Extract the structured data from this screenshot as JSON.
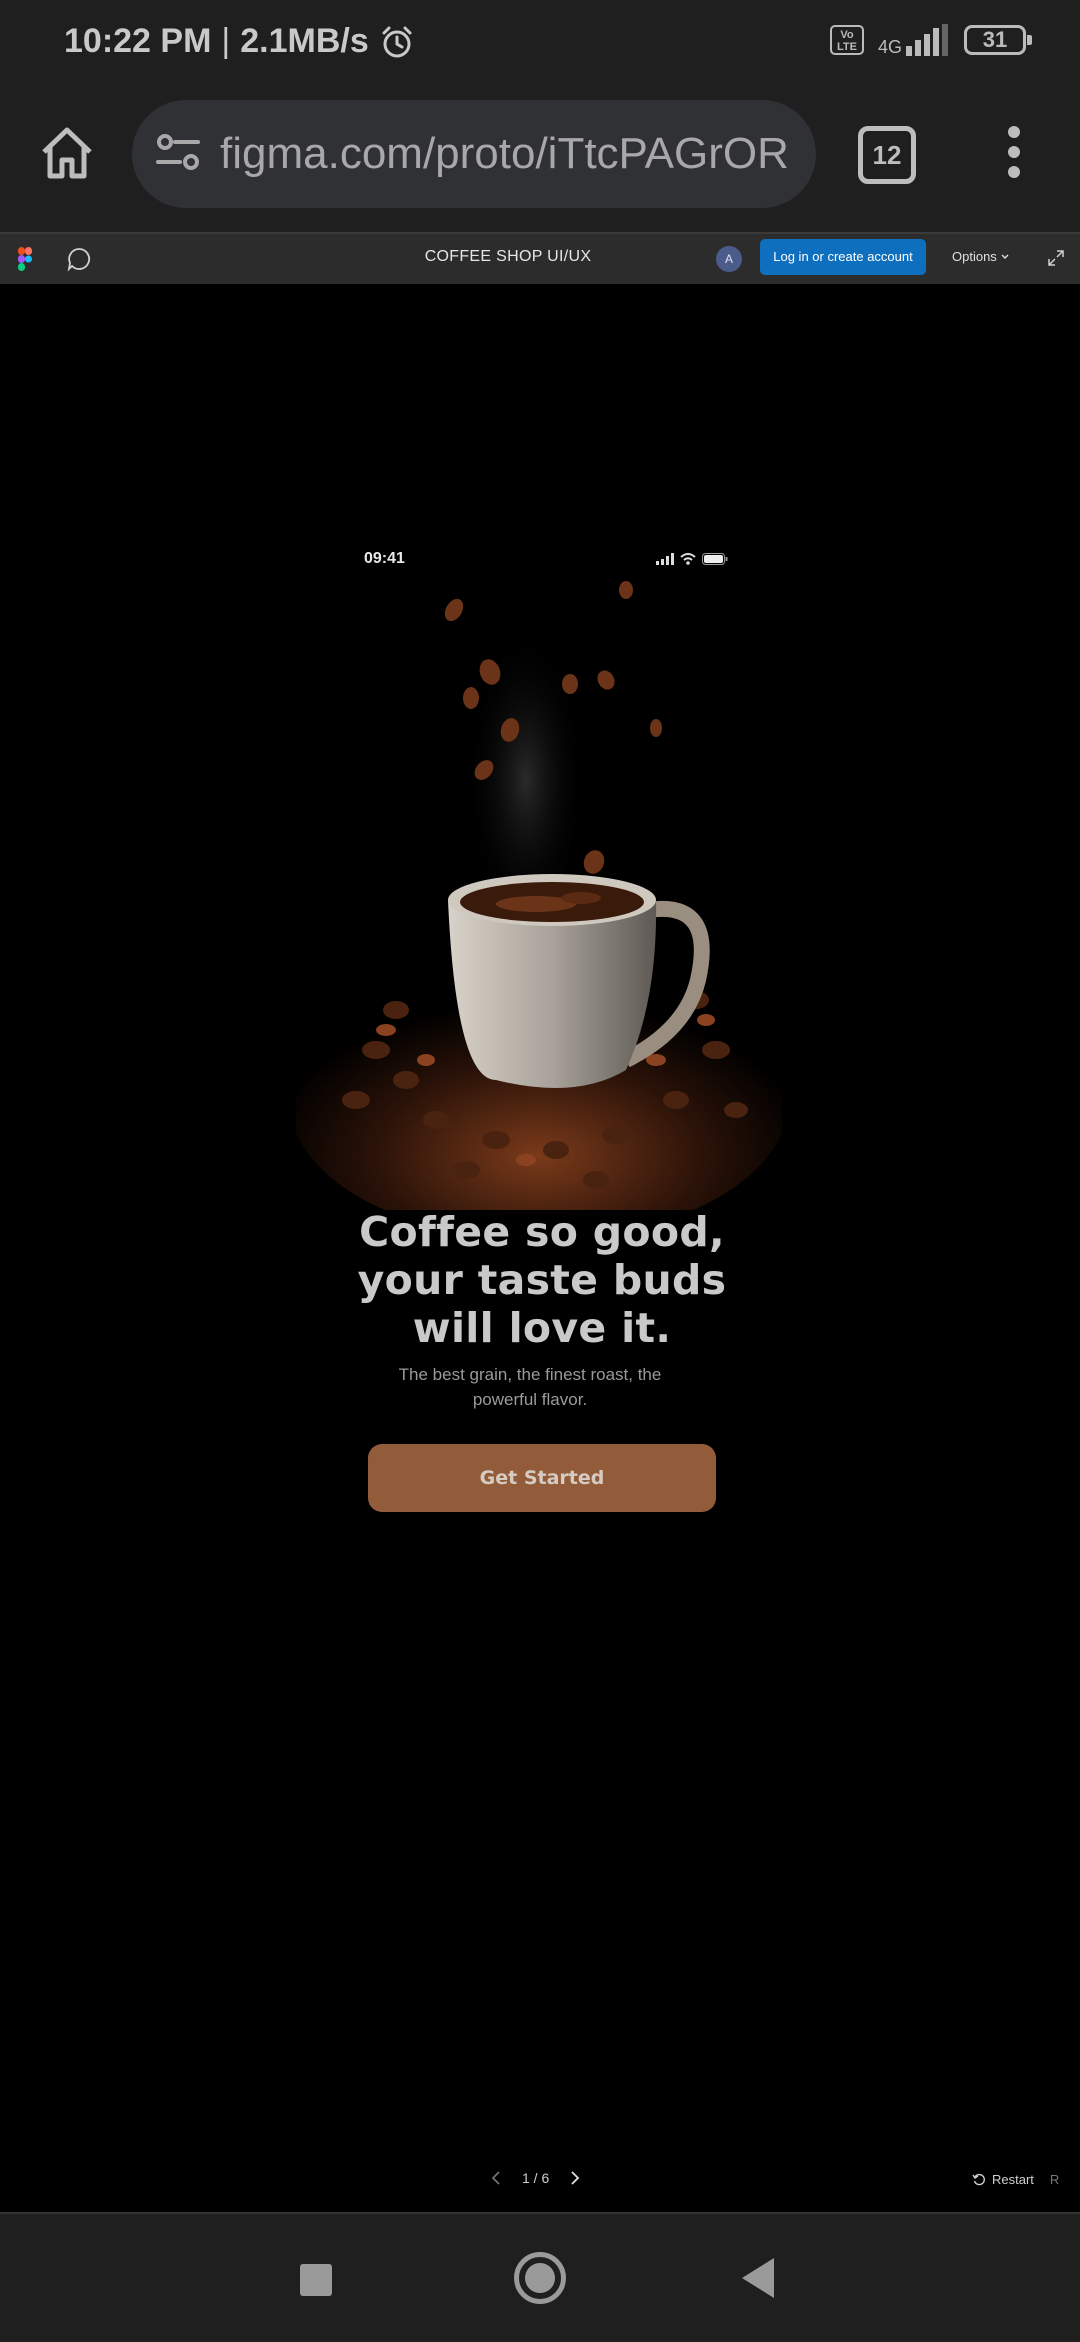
{
  "status_bar": {
    "time": "10:22 PM",
    "separator": "|",
    "speed": "2.1MB/s",
    "alarm_icon": "alarm-icon",
    "volte": "Vo LTE",
    "network": "4G",
    "battery": "31"
  },
  "browser": {
    "url": "figma.com/proto/iTtcPAGrOR",
    "tab_count": "12",
    "icons": [
      "home-icon",
      "site-settings-icon",
      "tabs-icon",
      "more-vert-icon"
    ]
  },
  "figma_header": {
    "title": "COFFEE SHOP UI/UX",
    "avatar": "A",
    "login": "Log in or create account",
    "options": "Options",
    "colors": {
      "login_bg": "#0d6fbd",
      "bar_bg": "#2c2c2c"
    }
  },
  "prototype": {
    "time": "09:41",
    "headline": [
      "Coffee so good,",
      "your taste buds",
      "will love it."
    ],
    "subtext": [
      "The best grain, the finest roast, the",
      "powerful flavor."
    ],
    "cta": "Get Started",
    "colors": {
      "cta_bg": "#925c3a"
    }
  },
  "footer": {
    "page": "1 / 6",
    "restart": "Restart",
    "restart_key": "R"
  }
}
